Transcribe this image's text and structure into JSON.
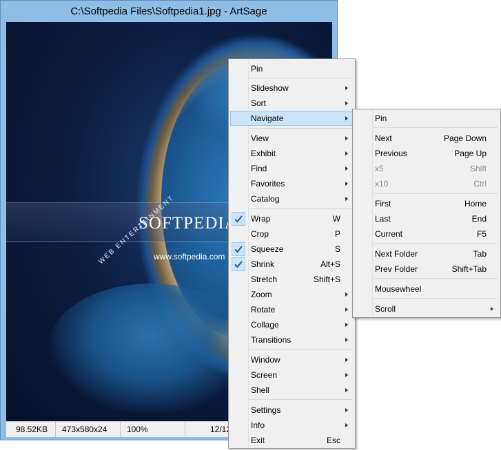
{
  "window": {
    "title": "C:\\Softpedia Files\\Softpedia1.jpg - ArtSage"
  },
  "image": {
    "brand_text": "SOFTPEDIA",
    "site_text": "www.softpedia.com",
    "arc_text": "WEB  ENTERTAINMENT"
  },
  "statusbar": {
    "size": "98.52KB",
    "dimensions": "473x580x24",
    "zoom": "100%",
    "position": "12/12"
  },
  "context_menu": {
    "items": [
      {
        "label": "Pin"
      },
      {
        "label": "Slideshow",
        "submenu": true
      },
      {
        "label": "Sort",
        "submenu": true
      },
      {
        "label": "Navigate",
        "submenu": true,
        "highlighted": true
      },
      {
        "label": "View",
        "submenu": true
      },
      {
        "label": "Exhibit",
        "submenu": true
      },
      {
        "label": "Find",
        "submenu": true
      },
      {
        "label": "Favorites",
        "submenu": true
      },
      {
        "label": "Catalog",
        "submenu": true
      },
      {
        "label": "Wrap",
        "shortcut": "W",
        "checked": true
      },
      {
        "label": "Crop",
        "shortcut": "P"
      },
      {
        "label": "Squeeze",
        "shortcut": "S",
        "checked": true
      },
      {
        "label": "Shrink",
        "shortcut": "Alt+S",
        "checked": true
      },
      {
        "label": "Stretch",
        "shortcut": "Shift+S"
      },
      {
        "label": "Zoom",
        "submenu": true
      },
      {
        "label": "Rotate",
        "submenu": true
      },
      {
        "label": "Collage",
        "submenu": true
      },
      {
        "label": "Transitions",
        "submenu": true
      },
      {
        "label": "Window",
        "submenu": true
      },
      {
        "label": "Screen",
        "submenu": true
      },
      {
        "label": "Shell",
        "submenu": true
      },
      {
        "label": "Settings",
        "submenu": true
      },
      {
        "label": "Info",
        "submenu": true
      },
      {
        "label": "Exit",
        "shortcut": "Esc"
      }
    ]
  },
  "navigate_submenu": {
    "items": [
      {
        "label": "Pin"
      },
      {
        "label": "Next",
        "shortcut": "Page Down"
      },
      {
        "label": "Previous",
        "shortcut": "Page Up"
      },
      {
        "label": "x5",
        "shortcut": "Shift",
        "disabled": true
      },
      {
        "label": "x10",
        "shortcut": "Ctrl",
        "disabled": true
      },
      {
        "label": "First",
        "shortcut": "Home"
      },
      {
        "label": "Last",
        "shortcut": "End"
      },
      {
        "label": "Current",
        "shortcut": "F5"
      },
      {
        "label": "Next Folder",
        "shortcut": "Tab"
      },
      {
        "label": "Prev Folder",
        "shortcut": "Shift+Tab"
      },
      {
        "label": "Mousewheel"
      },
      {
        "label": "Scroll",
        "submenu": true
      }
    ]
  },
  "colors": {
    "highlight": "#cce4f7",
    "highlight_border": "#99c9ef",
    "window_frame": "#8fbde6",
    "disabled_text": "#8d8d8d"
  }
}
